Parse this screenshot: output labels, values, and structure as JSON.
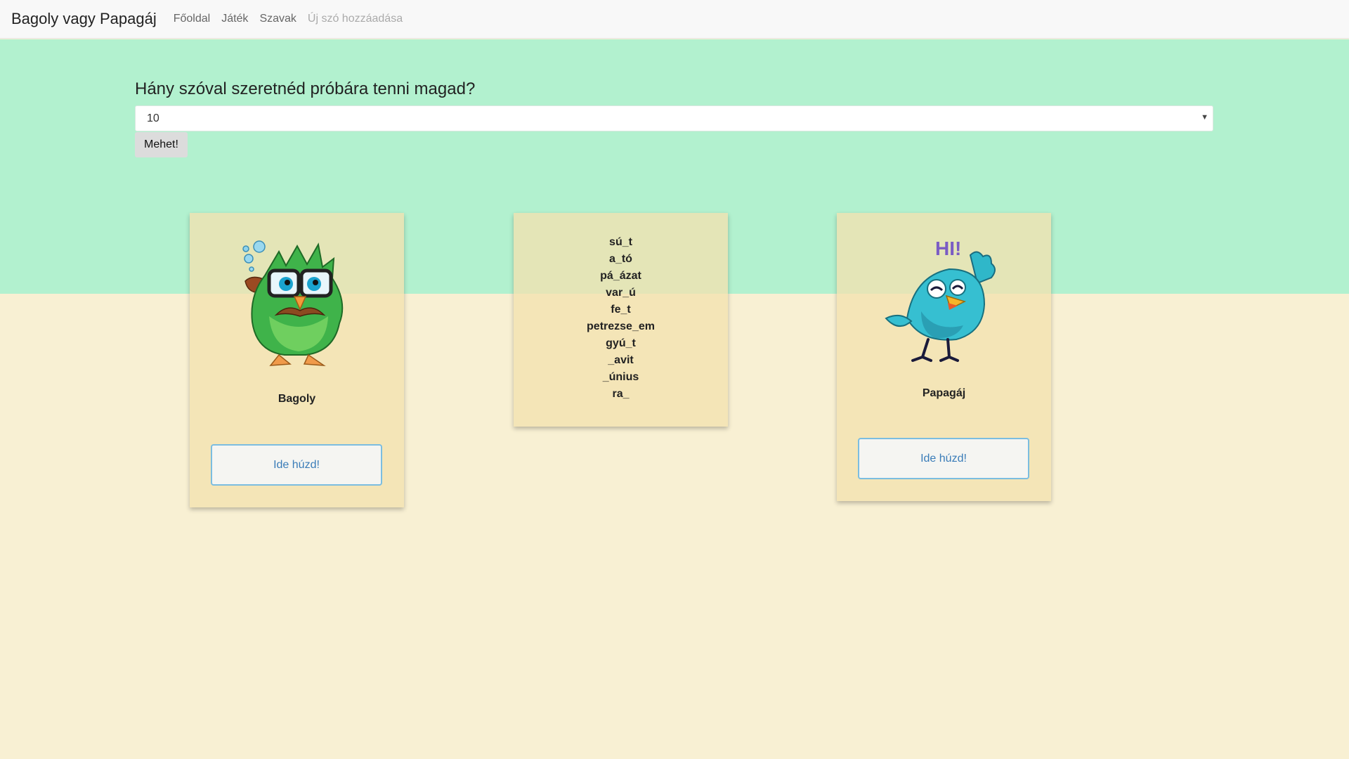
{
  "navbar": {
    "brand": "Bagoly vagy Papagáj",
    "links": [
      {
        "label": "Főoldal"
      },
      {
        "label": "Játék"
      },
      {
        "label": "Szavak"
      },
      {
        "label": "Új szó hozzáadása"
      }
    ]
  },
  "quiz": {
    "question": "Hány szóval szeretnéd próbára tenni magad?",
    "selected_count": "10",
    "go_button": "Mehet!"
  },
  "cards": {
    "owl": {
      "title": "Bagoly",
      "drop_label": "Ide húzd!"
    },
    "parrot": {
      "title": "Papagáj",
      "drop_label": "Ide húzd!",
      "hi_text": "HI!"
    }
  },
  "words": [
    "sú_t",
    "a_tó",
    "pá_ázat",
    "var_ú",
    "fe_t",
    "petrezse_em",
    "gyú_t",
    "_avit",
    "_únius",
    "ra_"
  ],
  "colors": {
    "hero_bg": "#b2f1cf",
    "page_bg": "#f8f0d3",
    "card_bg": "#f2e2b0",
    "drop_border": "#7bbde0"
  }
}
